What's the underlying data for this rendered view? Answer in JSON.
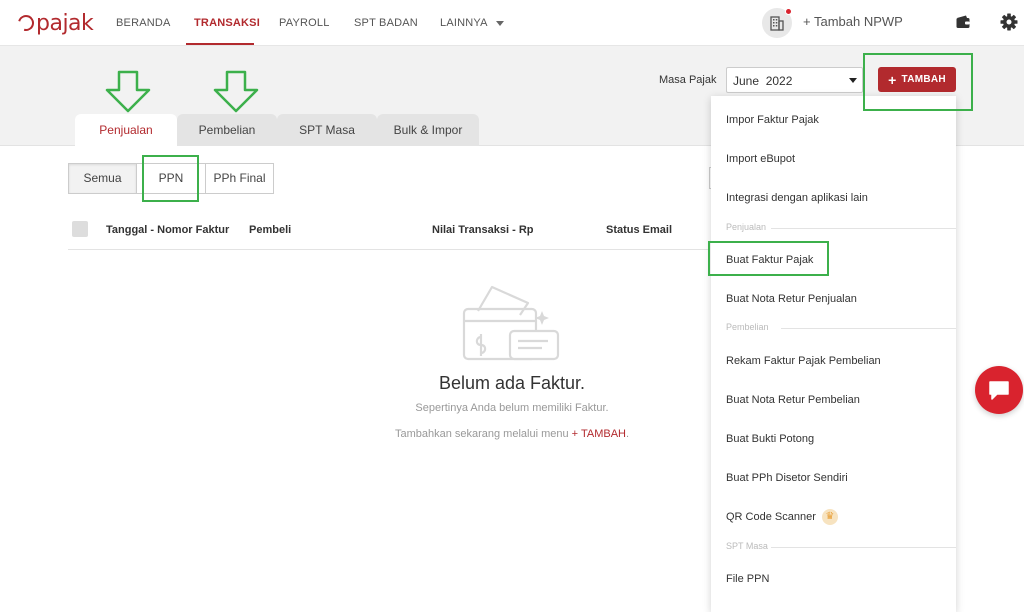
{
  "brand": {
    "name": "pajak",
    "accent": "#b22a2e",
    "annotation": "#3cb04b"
  },
  "nav": {
    "items": [
      "BERANDA",
      "TRANSAKSI",
      "PAYROLL",
      "SPT BADAN",
      "LAINNYA"
    ],
    "active": "TRANSAKSI",
    "add_npwp": "+ Tambah NPWP"
  },
  "period": {
    "label": "Masa Pajak",
    "value": "June  2022"
  },
  "add_button": {
    "label": "TAMBAH"
  },
  "tabs": [
    "Penjualan",
    "Pembelian",
    "SPT Masa",
    "Bulk & Impor"
  ],
  "filters": [
    "Semua",
    "PPN",
    "PPh Final"
  ],
  "table": {
    "columns": [
      "Tanggal - Nomor Faktur",
      "Pembeli",
      "Nilai Transaksi - Rp",
      "Status Email"
    ]
  },
  "empty": {
    "title": "Belum ada Faktur.",
    "subtitle": "Sepertinya Anda belum memiliki Faktur.",
    "hint_prefix": "Tambahkan sekarang melalui menu",
    "hint_link": "+ TAMBAH",
    "hint_suffix": "."
  },
  "menu": {
    "items_top": [
      "Impor Faktur Pajak",
      "Import eBupot",
      "Integrasi dengan aplikasi lain"
    ],
    "section_penjualan": "Penjualan",
    "items_penjualan": [
      "Buat Faktur Pajak",
      "Buat Nota Retur Penjualan"
    ],
    "section_pembelian": "Pembelian",
    "items_pembelian": [
      "Rekam Faktur Pajak Pembelian",
      "Buat Nota Retur Pembelian",
      "Buat Bukti Potong",
      "Buat PPh Disetor Sendiri",
      "QR Code Scanner"
    ],
    "section_spt": "SPT Masa",
    "items_spt": [
      "File PPN"
    ]
  }
}
